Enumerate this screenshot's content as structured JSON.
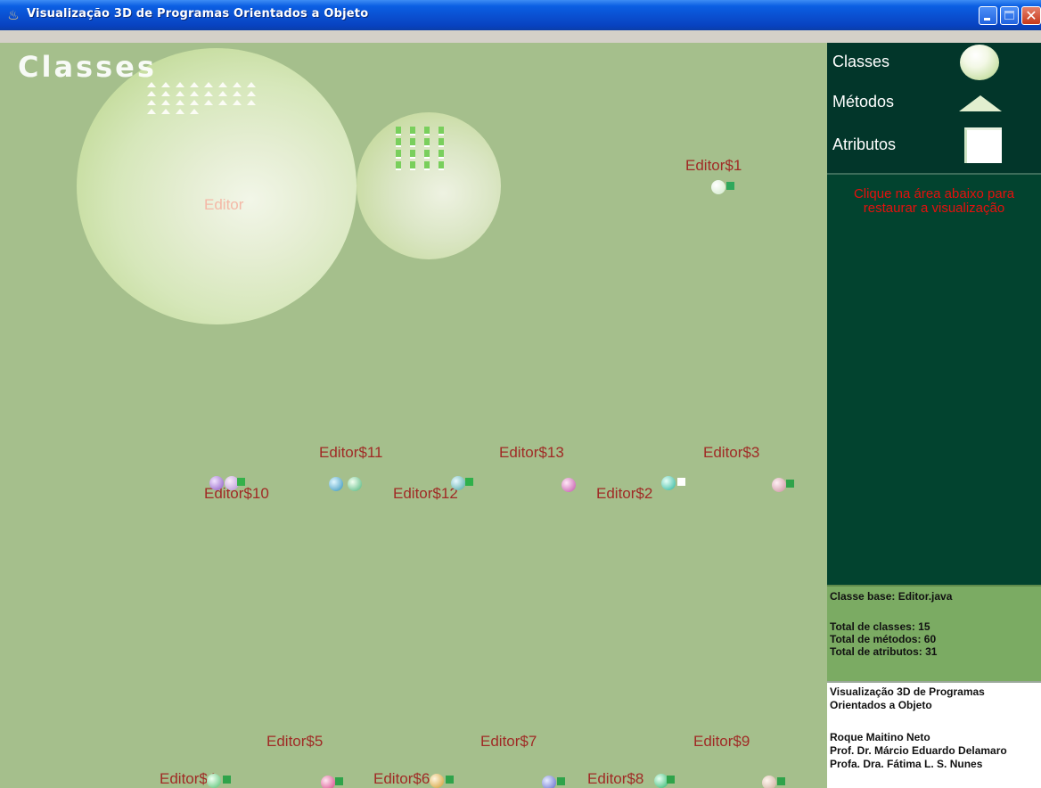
{
  "window": {
    "title": "Visualização 3D de Programas Orientados a Objeto"
  },
  "canvas": {
    "title": "Classes",
    "main_class": "Editor",
    "inner_classes": [
      "Editor$1",
      "Editor$11",
      "Editor$13",
      "Editor$3",
      "Editor$10",
      "Editor$12",
      "Editor$2",
      "Editor$5",
      "Editor$7",
      "Editor$9",
      "Editor$4",
      "Editor$6",
      "Editor$8"
    ]
  },
  "legend": {
    "classes": "Classes",
    "methods": "Métodos",
    "attributes": "Atributos",
    "icons": [
      "sphere-icon",
      "triangle-icon",
      "cube-icon"
    ]
  },
  "restore": {
    "line1": "Clique na área abaixo para",
    "line2": "restaurar a visualização"
  },
  "stats": {
    "base_class": "Classe base: Editor.java",
    "total_classes": "Total de classes: 15",
    "total_methods": "Total de métodos: 60",
    "total_attributes": "Total de atributos: 31"
  },
  "credits": {
    "title_line1": "Visualização 3D de Programas",
    "title_line2": "Orientados a Objeto",
    "author1": "Roque Maitino Neto",
    "author2": "Prof. Dr. Márcio Eduardo Delamaro",
    "author3": "Profa. Dra. Fátima L. S. Nunes"
  },
  "colors": {
    "canvas_bg": "#a5bf8c",
    "legend_bg": "#02362a",
    "restore_bg": "#02432f",
    "restore_text": "#e6100d",
    "stats_bg": "#7bab63",
    "class_label": "#a02b26"
  }
}
